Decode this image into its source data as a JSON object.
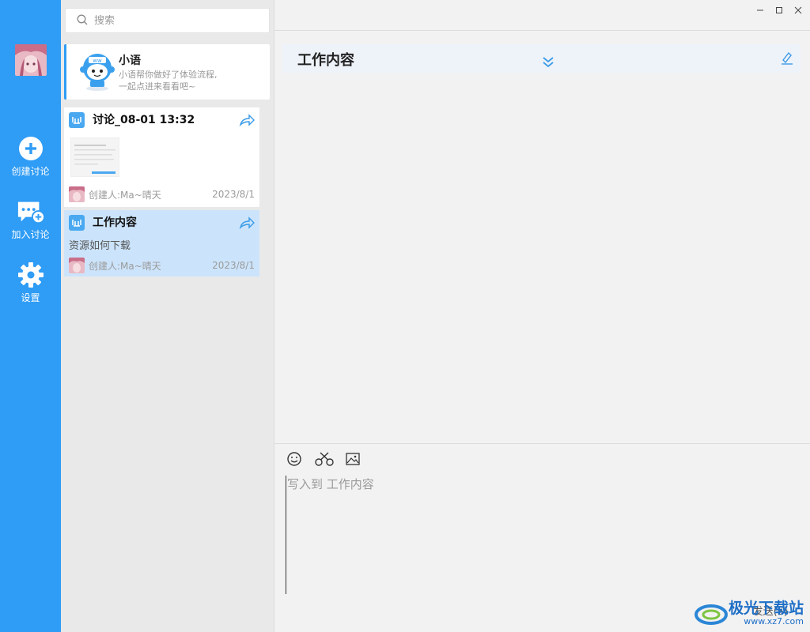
{
  "colors": {
    "rail": "#2f9cf5",
    "selected": "#cce4fb",
    "accent": "#4aa8f0"
  },
  "rail": {
    "avatar": "user-avatar",
    "buttons": [
      {
        "label": "创建讨论",
        "icon": "plus-circle-icon"
      },
      {
        "label": "加入讨论",
        "icon": "chat-add-icon"
      },
      {
        "label": "设置",
        "icon": "gear-icon"
      }
    ]
  },
  "search": {
    "placeholder": "搜索",
    "value": ""
  },
  "bot": {
    "name": "小语",
    "desc_line1": "小语帮你做好了体验流程,",
    "desc_line2": "一起点进来看看吧~"
  },
  "discussions": [
    {
      "title": "讨论_08-01 13:32",
      "body": "",
      "creator": "创建人:Ma~晴天",
      "date": "2023/8/1",
      "selected": false
    },
    {
      "title": "工作内容",
      "body": "资源如何下载",
      "creator": "创建人:Ma~晴天",
      "date": "2023/8/1",
      "selected": true
    }
  ],
  "topic": {
    "title": "工作内容"
  },
  "composer": {
    "placeholder": "写入到 工作内容",
    "send_label": "发送(S)",
    "tools": [
      "emoji-icon",
      "scissors-icon",
      "image-icon"
    ]
  },
  "watermark": {
    "text": "极光下载站",
    "url": "www.xz7.com"
  }
}
